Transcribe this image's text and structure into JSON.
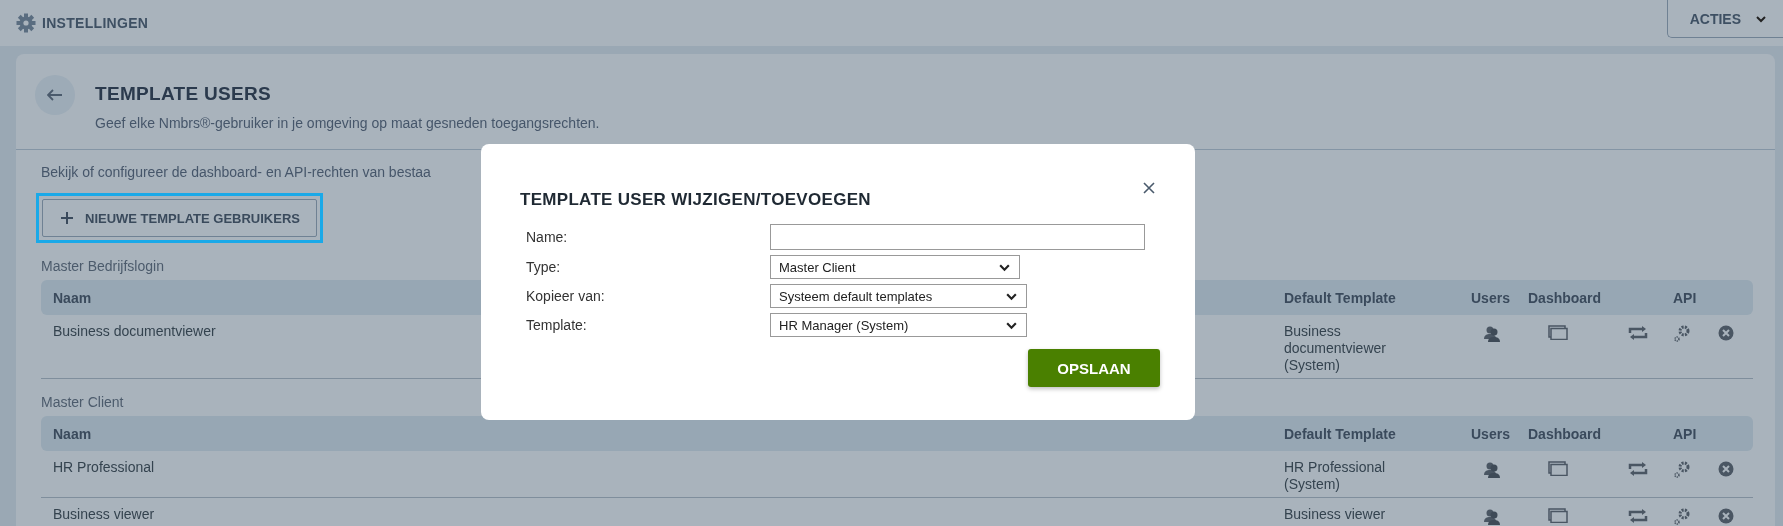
{
  "top_bar": {
    "title": "INSTELLINGEN",
    "actions_button": "ACTIES"
  },
  "page": {
    "title": "TEMPLATE USERS",
    "subtitle": "Geef elke Nmbrs®-gebruiker in je omgeving op maat gesneden toegangsrechten.",
    "intro": "Bekijk of configureer de dashboard- en API-rechten van bestaa",
    "new_button": {
      "label": "NIEUWE TEMPLATE GEBRUIKERS",
      "focused": true
    }
  },
  "groups": [
    {
      "title": "Master Bedrijfslogin",
      "columns": [
        "Naam",
        "Default Template",
        "Users",
        "Dashboard",
        "API"
      ],
      "rows": [
        {
          "naam": "Business documentviewer",
          "default_template": "Business documentviewer (System)"
        }
      ]
    },
    {
      "title": "Master Client",
      "columns": [
        "Naam",
        "Default Template",
        "Users",
        "Dashboard",
        "API"
      ],
      "rows": [
        {
          "naam": "HR Professional",
          "default_template": "HR Professional (System)"
        },
        {
          "naam": "Business viewer",
          "default_template": "Business viewer"
        }
      ]
    }
  ],
  "modal": {
    "title": "TEMPLATE USER WIJZIGEN/TOEVOEGEN",
    "fields": [
      {
        "label": "Name:",
        "kind": "text"
      },
      {
        "label": "Type:",
        "kind": "select",
        "value": "Master Client"
      },
      {
        "label": "Kopieer van:",
        "kind": "select",
        "value": "Systeem default templates"
      },
      {
        "label": "Template:",
        "kind": "select",
        "value": "HR Manager (System)"
      }
    ],
    "save_button": "OPSLAAN"
  }
}
